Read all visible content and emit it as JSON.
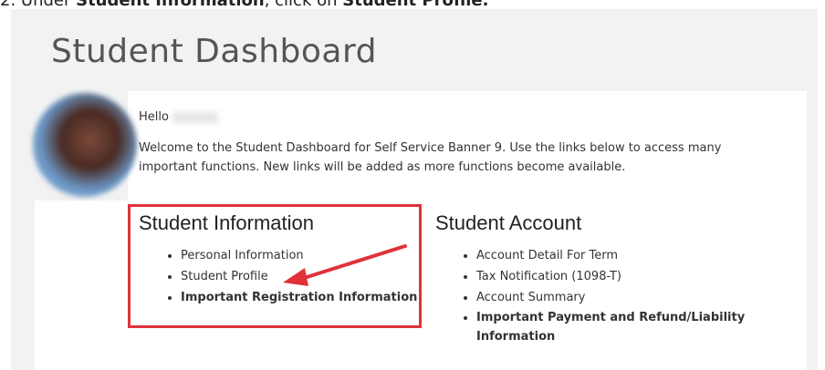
{
  "instruction": {
    "prefix": "2. Under ",
    "section": "Student Information",
    "middle": ", click on ",
    "target": "Student Profile."
  },
  "page": {
    "title": "Student Dashboard",
    "hello": "Hello",
    "welcome": "Welcome to the Student Dashboard for Self Service Banner 9. Use the links below to access many important functions. New links will be added as more functions become available."
  },
  "student_information": {
    "title": "Student Information",
    "links": [
      "Personal Information",
      "Student Profile",
      "Important Registration Information"
    ]
  },
  "student_account": {
    "title": "Student Account",
    "links": [
      "Account Detail For Term",
      "Tax Notification (1098-T)",
      "Account Summary",
      "Important Payment and Refund/Liability Information"
    ]
  },
  "annotation_color": "#e0323a"
}
